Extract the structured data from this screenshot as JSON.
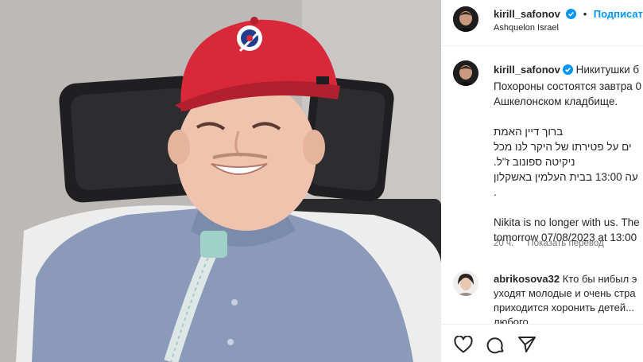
{
  "post": {
    "photo_alt": "",
    "header": {
      "username": "kirill_safonov",
      "separator": "•",
      "follow_label": "Подписаться",
      "location": "Ashquelon Israel"
    },
    "caption": {
      "username": "kirill_safonov",
      "lines": [
        "Никитушки б",
        "Похороны состоятся завтра 0",
        "Ашкелонском кладбище.",
        "",
        "ברוך דיין האמת",
        "ים על פטירתו של היקר לנו מכל",
        "ניקיטה ספונוב ז\"ל.",
        "עה 13:00 בבית העלמין באשקלון",
        ".",
        "",
        "Nikita is no longer with us. The",
        "tomorrow 07/08/2023 at 13:00"
      ],
      "time": "20 ч.",
      "translate_label": "Показать перевод"
    },
    "comment": {
      "username": "abrikosova32",
      "lines": [
        "Кто бы нибыл э",
        "уходят молодые и очень стра",
        "приходится хоронить детей...",
        "любого"
      ]
    },
    "actions": {
      "like_icon": "heart-icon",
      "comment_icon": "comment-icon",
      "share_icon": "share-icon"
    }
  },
  "colors": {
    "accent": "#0095f6",
    "cap_red": "#d8283a",
    "shirt": "#8a9ab8",
    "verified": "#0095f6"
  }
}
